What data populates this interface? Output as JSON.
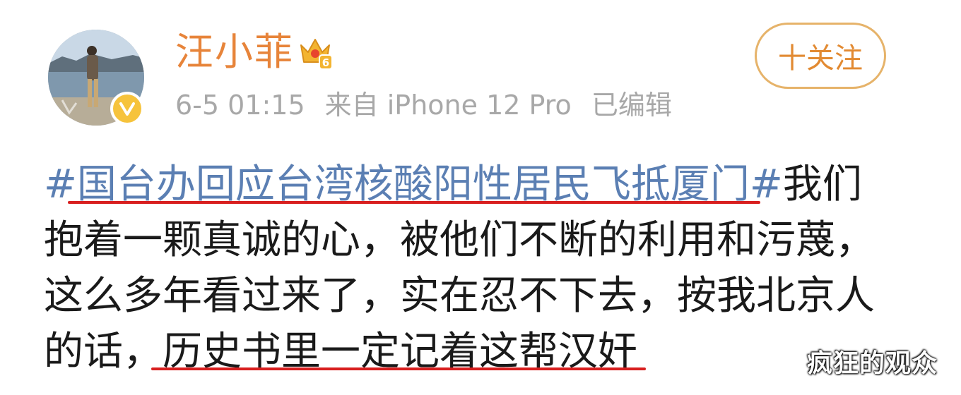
{
  "header": {
    "username": "汪小菲",
    "crown_level": "6",
    "timestamp": "6-5 01:15",
    "source": "来自 iPhone 12 Pro",
    "edited": "已编辑",
    "follow_label": "十关注",
    "verified_mark": "V"
  },
  "icons": {
    "avatar": "avatar-photo",
    "verified": "verified-v-icon",
    "crown": "crown-icon"
  },
  "post": {
    "hashtag": "#国台办回应台湾核酸阳性居民飞抵厦门#",
    "line1_rest": "我们",
    "line2": "抱着一颗真诚的心，被他们不断的利用和污蔑，",
    "line3": "这么多年看过来了，实在忍不下去，按我北京人",
    "line4_prefix": "的话，",
    "line4_highlight": "历史书里一定记着这帮汉奸"
  },
  "watermark": "疯狂的观众",
  "colors": {
    "name": "#e7843a",
    "meta": "#a8a8a8",
    "hashtag": "#5b7fb3",
    "follow_border": "#e6b36a",
    "annotation_red": "#d81f1f"
  }
}
